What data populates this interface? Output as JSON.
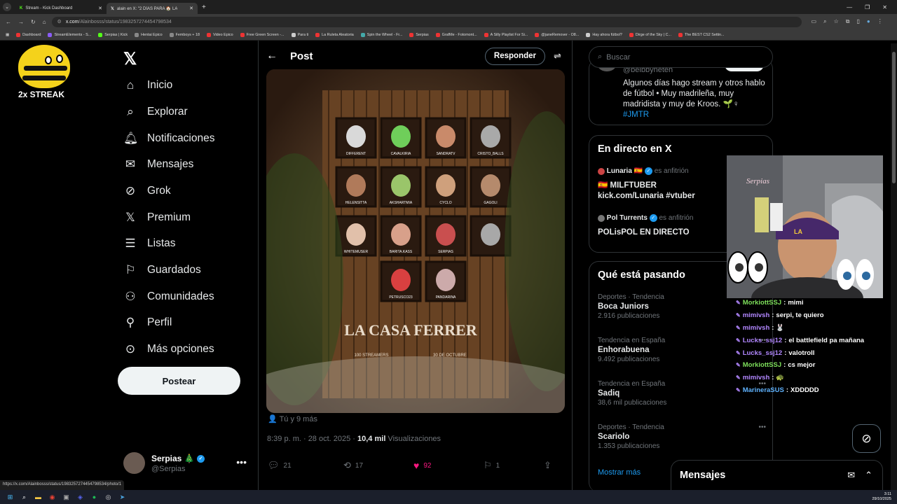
{
  "browser": {
    "tabs": [
      {
        "title": "Stream - Kick Dashboard",
        "active": false
      },
      {
        "title": "alain en X: \"2 DÍAS PARA 🏠 LA",
        "active": true
      }
    ],
    "url_host": "x.com",
    "url_path": "/Alainbosss/status/1983257274454798534",
    "bookmarks": [
      "Dashboard",
      "StreamElements - S...",
      "Serpias | Kick",
      "Hentai Epico",
      "Femboys + 18",
      "Video Epico",
      "Free Green Screen -...",
      "Para ti",
      "La Ruleta Aleatoria",
      "Spin the Wheel - Fr...",
      "Serpias",
      "GrafMe - Fotomont...",
      "A Silly Playlist For Si...",
      "@janeRemover - O8...",
      "Hay ahora fútbol?",
      "Dirge of the Sky | C...",
      "The BEST CS2 Settin..."
    ],
    "status_url": "https://x.com/Alainbosss/status/1983257274454798534/photo/1"
  },
  "overlay": {
    "streak": "2x STREAK"
  },
  "nav": {
    "items": [
      "Inicio",
      "Explorar",
      "Notificaciones",
      "Mensajes",
      "Grok",
      "Premium",
      "Listas",
      "Guardados",
      "Comunidades",
      "Perfil",
      "Más opciones"
    ],
    "icons": [
      "home-icon",
      "search-icon",
      "bell-icon",
      "mail-icon",
      "grok-icon",
      "x-premium-icon",
      "list-icon",
      "bookmark-icon",
      "communities-icon",
      "profile-icon",
      "more-options-icon"
    ],
    "post_button": "Postear",
    "account_name": "Serpias 🎄",
    "account_handle": "@Serpias"
  },
  "post": {
    "header_title": "Post",
    "reply_button": "Responder",
    "tagged": "Tú y 9 más",
    "time": "8:39 p. m. · 28 oct. 2025 · ",
    "views_count": "10,4 mil",
    "views_label": " Visualizaciones",
    "replies": "21",
    "reposts": "17",
    "likes": "92",
    "bookmarks": "1",
    "image_texts": [
      "LA CASA FERRER",
      "100 STREAMERS",
      "30 DE OCTUBRE"
    ],
    "frame_names": [
      "DIFFERENT",
      "CAVALKIRIA",
      "SANDRATV",
      "CRISTO_BALLS",
      "HELENSITTA",
      "AKSHARTMIA",
      "CYCLO",
      "GAGOLI",
      "WHITEMUSER",
      "BARITA.KASS",
      "SERPIAS",
      "",
      "PETRUSCO23",
      "PANDARINA"
    ]
  },
  "right": {
    "search_placeholder": "Buscar",
    "bio_handle": "@beibbyneten",
    "bio_text": "Algunos días hago stream y otros hablo de fútbol • Muy madrileña, muy madridista y muy de Kroos. 🌱♀",
    "bio_hashtag": "#JMTR",
    "live_title": "En directo en X",
    "live": [
      {
        "host": "Lunaria 🇪🇸",
        "role": "es anfitrión",
        "text": "🇪🇸 MILFTUBER kick.com/Lunaria #vtuber"
      },
      {
        "host": "Pol Turrents",
        "role": "es anfitrión",
        "text": "POLisPOL EN DIRECTO"
      }
    ],
    "trends_title": "Qué está pasando",
    "trends": [
      {
        "category": "Deportes · Tendencia",
        "name": "Boca Juniors",
        "count": "2.916 publicaciones"
      },
      {
        "category": "Tendencia en España",
        "name": "Enhorabuena",
        "count": "9.492 publicaciones"
      },
      {
        "category": "Tendencia en España",
        "name": "Sadiq",
        "count": "38,6 mil publicaciones"
      },
      {
        "category": "Deportes · Tendencia",
        "name": "Scariolo",
        "count": "1.353 publicaciones"
      }
    ],
    "show_more": "Mostrar más",
    "messages": "Mensajes"
  },
  "chat": [
    {
      "user": "MorkiottSSJ",
      "msg": "mimi",
      "color": "#7ee05b"
    },
    {
      "user": "mimivsh",
      "msg": "serpi, te quiero",
      "color": "#b287ff"
    },
    {
      "user": "mimivsh",
      "msg": "🐰",
      "color": "#b287ff"
    },
    {
      "user": "Lucks_ssj12",
      "msg": "el battlefield pa mañana",
      "color": "#b287ff"
    },
    {
      "user": "Lucks_ssj12",
      "msg": "valotroll",
      "color": "#b287ff"
    },
    {
      "user": "MorkiottSSJ",
      "msg": "cs mejor",
      "color": "#7ee05b"
    },
    {
      "user": "mimivsh",
      "msg": "🐢",
      "color": "#b287ff"
    },
    {
      "user": "MarineraSUS",
      "msg": "XDDDDD",
      "color": "#5fb3ff"
    }
  ],
  "taskbar": {
    "time": "3:11",
    "date": "29/10/2025"
  },
  "colors": {
    "accent": "#1d9bf0",
    "like": "#f91880",
    "bg": "#000000",
    "border": "#2f3336"
  }
}
